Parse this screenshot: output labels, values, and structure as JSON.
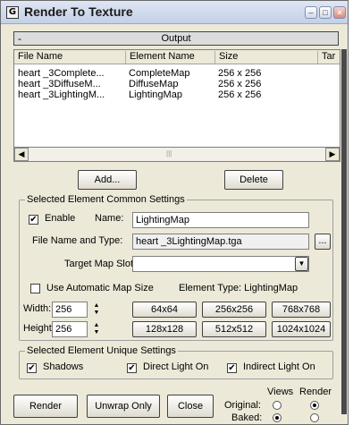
{
  "window": {
    "title": "Render To Texture",
    "icon_glyph": "G"
  },
  "output": {
    "section_label": "Output",
    "collapse_glyph": "-",
    "columns": [
      "File Name",
      "Element Name",
      "Size",
      "Tar"
    ],
    "rows": [
      {
        "file": "heart _3Complete...",
        "element": "CompleteMap",
        "size": "256  x  256"
      },
      {
        "file": "heart _3DiffuseM...",
        "element": "DiffuseMap",
        "size": "256  x  256"
      },
      {
        "file": "heart _3LightingM...",
        "element": "LightingMap",
        "size": "256  x  256"
      }
    ]
  },
  "list_buttons": {
    "add": "Add...",
    "delete": "Delete"
  },
  "common": {
    "title": "Selected Element Common Settings",
    "enable_label": "Enable",
    "enable_checked": true,
    "name_label": "Name:",
    "name_value": "LightingMap",
    "file_label": "File Name and Type:",
    "file_value": "heart _3LightingMap.tga",
    "browse_label": "...",
    "target_label": "Target Map Slot:",
    "target_value": "",
    "auto_size_label": "Use Automatic Map Size",
    "auto_size_checked": false,
    "element_type": "Element Type: LightingMap",
    "width_label": "Width:",
    "width_value": "256",
    "height_label": "Height:",
    "height_value": "256",
    "size_buttons_row1": [
      "64x64",
      "256x256",
      "768x768"
    ],
    "size_buttons_row2": [
      "128x128",
      "512x512",
      "1024x1024"
    ]
  },
  "unique": {
    "title": "Selected Element Unique Settings",
    "shadows_label": "Shadows",
    "direct_label": "Direct Light On",
    "indirect_label": "Indirect Light On",
    "shadows_checked": true,
    "direct_checked": true,
    "indirect_checked": true
  },
  "footer": {
    "render": "Render",
    "unwrap": "Unwrap Only",
    "close": "Close",
    "views_label": "Views",
    "render_label": "Render",
    "original_label": "Original:",
    "baked_label": "Baked:",
    "original_views": false,
    "original_render": true,
    "baked_views": true,
    "baked_render": false
  },
  "glyphs": {
    "check": "✔",
    "left": "◀",
    "right": "▶",
    "up": "▲",
    "down": "▼",
    "minimize": "–",
    "maximize": "□",
    "close": "×"
  }
}
